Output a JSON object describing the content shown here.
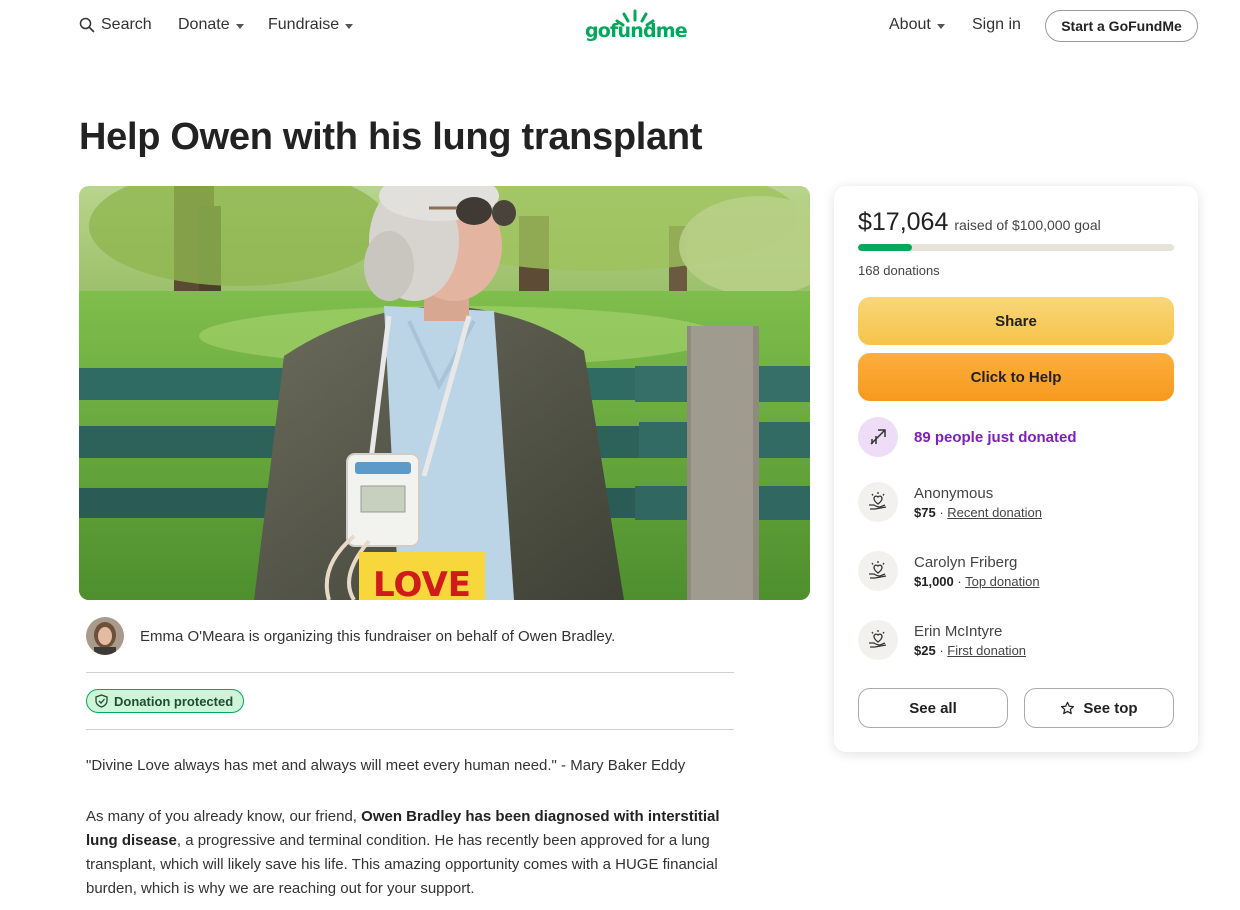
{
  "nav": {
    "search_label": "Search",
    "donate_label": "Donate",
    "fundraise_label": "Fundraise",
    "logo_text": "gofundme",
    "about_label": "About",
    "signin_label": "Sign in",
    "start_label": "Start a GoFundMe"
  },
  "campaign": {
    "title": "Help Owen with his lung transplant",
    "hero_sign_text": "LOVE",
    "organizer_text": "Emma O'Meara is organizing this fundraiser on behalf of Owen Bradley.",
    "protected_label": "Donation protected",
    "quote": "\"Divine Love always has met and always will meet every human need.\" - Mary Baker Eddy",
    "story_intro": "As many of you already know, our friend, ",
    "story_bold": "Owen Bradley has been diagnosed with interstitial lung disease",
    "story_rest": ", a progressive and terminal condition. He has recently been approved for a lung transplant, which will likely save his life. This amazing opportunity comes with a HUGE financial burden, which is why we are reaching out for your support."
  },
  "card": {
    "raised_amount": "$17,064",
    "raised_label": "raised of $100,000 goal",
    "progress_fraction": 0.17064,
    "donation_count": "168 donations",
    "share_label": "Share",
    "help_label": "Click to Help",
    "trend_text": "89 people just donated",
    "donors": [
      {
        "name": "Anonymous",
        "amount": "$75",
        "tag": "Recent donation"
      },
      {
        "name": "Carolyn Friberg",
        "amount": "$1,000",
        "tag": "Top donation"
      },
      {
        "name": "Erin McIntyre",
        "amount": "$25",
        "tag": "First donation"
      }
    ],
    "see_all_label": "See all",
    "see_top_label": "See top"
  },
  "colors": {
    "brand_green": "#02a95c",
    "share_yellow": "#f5c34a",
    "help_orange": "#f69a1d",
    "trend_purple": "#7d1fbb"
  },
  "icons": {
    "search": "search-icon",
    "trend": "trending-up-icon",
    "donor": "heart-hand-icon",
    "shield": "shield-icon",
    "star": "star-icon"
  }
}
